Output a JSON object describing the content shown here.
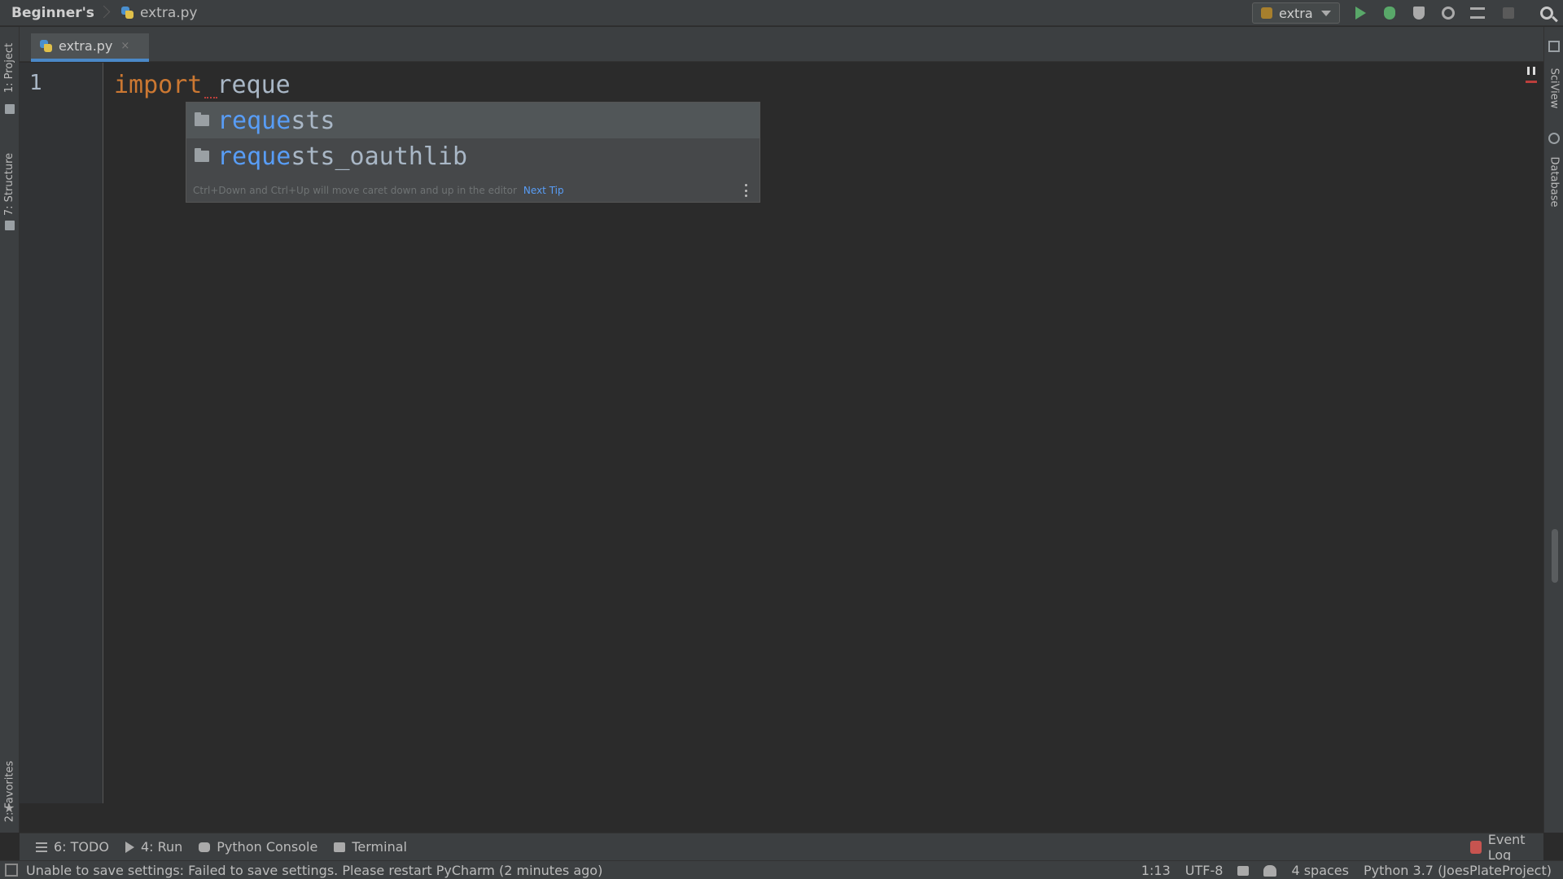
{
  "navbar": {
    "project": "Beginner's",
    "file": "extra.py",
    "run_config": "extra"
  },
  "left_tabs": {
    "project": "1: Project",
    "structure": "7: Structure",
    "favorites": "2: Favorites"
  },
  "right_tabs": {
    "sciview": "SciView",
    "database": "Database"
  },
  "editor_tab": {
    "label": "extra.py",
    "close": "×"
  },
  "editor": {
    "line_number": "1",
    "keyword": "import",
    "typed": "reque"
  },
  "completion": {
    "items": [
      {
        "match": "reque",
        "rest": "sts"
      },
      {
        "match": "reque",
        "rest": "sts_oauthlib"
      }
    ],
    "tip": "Ctrl+Down and Ctrl+Up will move caret down and up in the editor",
    "next_tip": "Next Tip"
  },
  "bottom_tools": {
    "todo": "6: TODO",
    "run": "4: Run",
    "python_console": "Python Console",
    "terminal": "Terminal",
    "event_log": "Event Log"
  },
  "status": {
    "message": "Unable to save settings: Failed to save settings. Please restart PyCharm (2 minutes ago)",
    "position": "1:13",
    "encoding": "UTF-8",
    "indent": "4 spaces",
    "interpreter": "Python 3.7 (JoesPlateProject)"
  },
  "icons": {
    "file": "python-file-icon",
    "run": "run-icon",
    "debug": "debug-icon",
    "coverage": "coverage-icon",
    "profile": "profile-icon",
    "build": "build-icon",
    "stop": "stop-icon",
    "search": "search-icon",
    "folder": "folder-icon"
  },
  "colors": {
    "keyword": "#cc7832",
    "match": "#589df6",
    "run_green": "#59a869",
    "error": "#bc3f3c"
  }
}
